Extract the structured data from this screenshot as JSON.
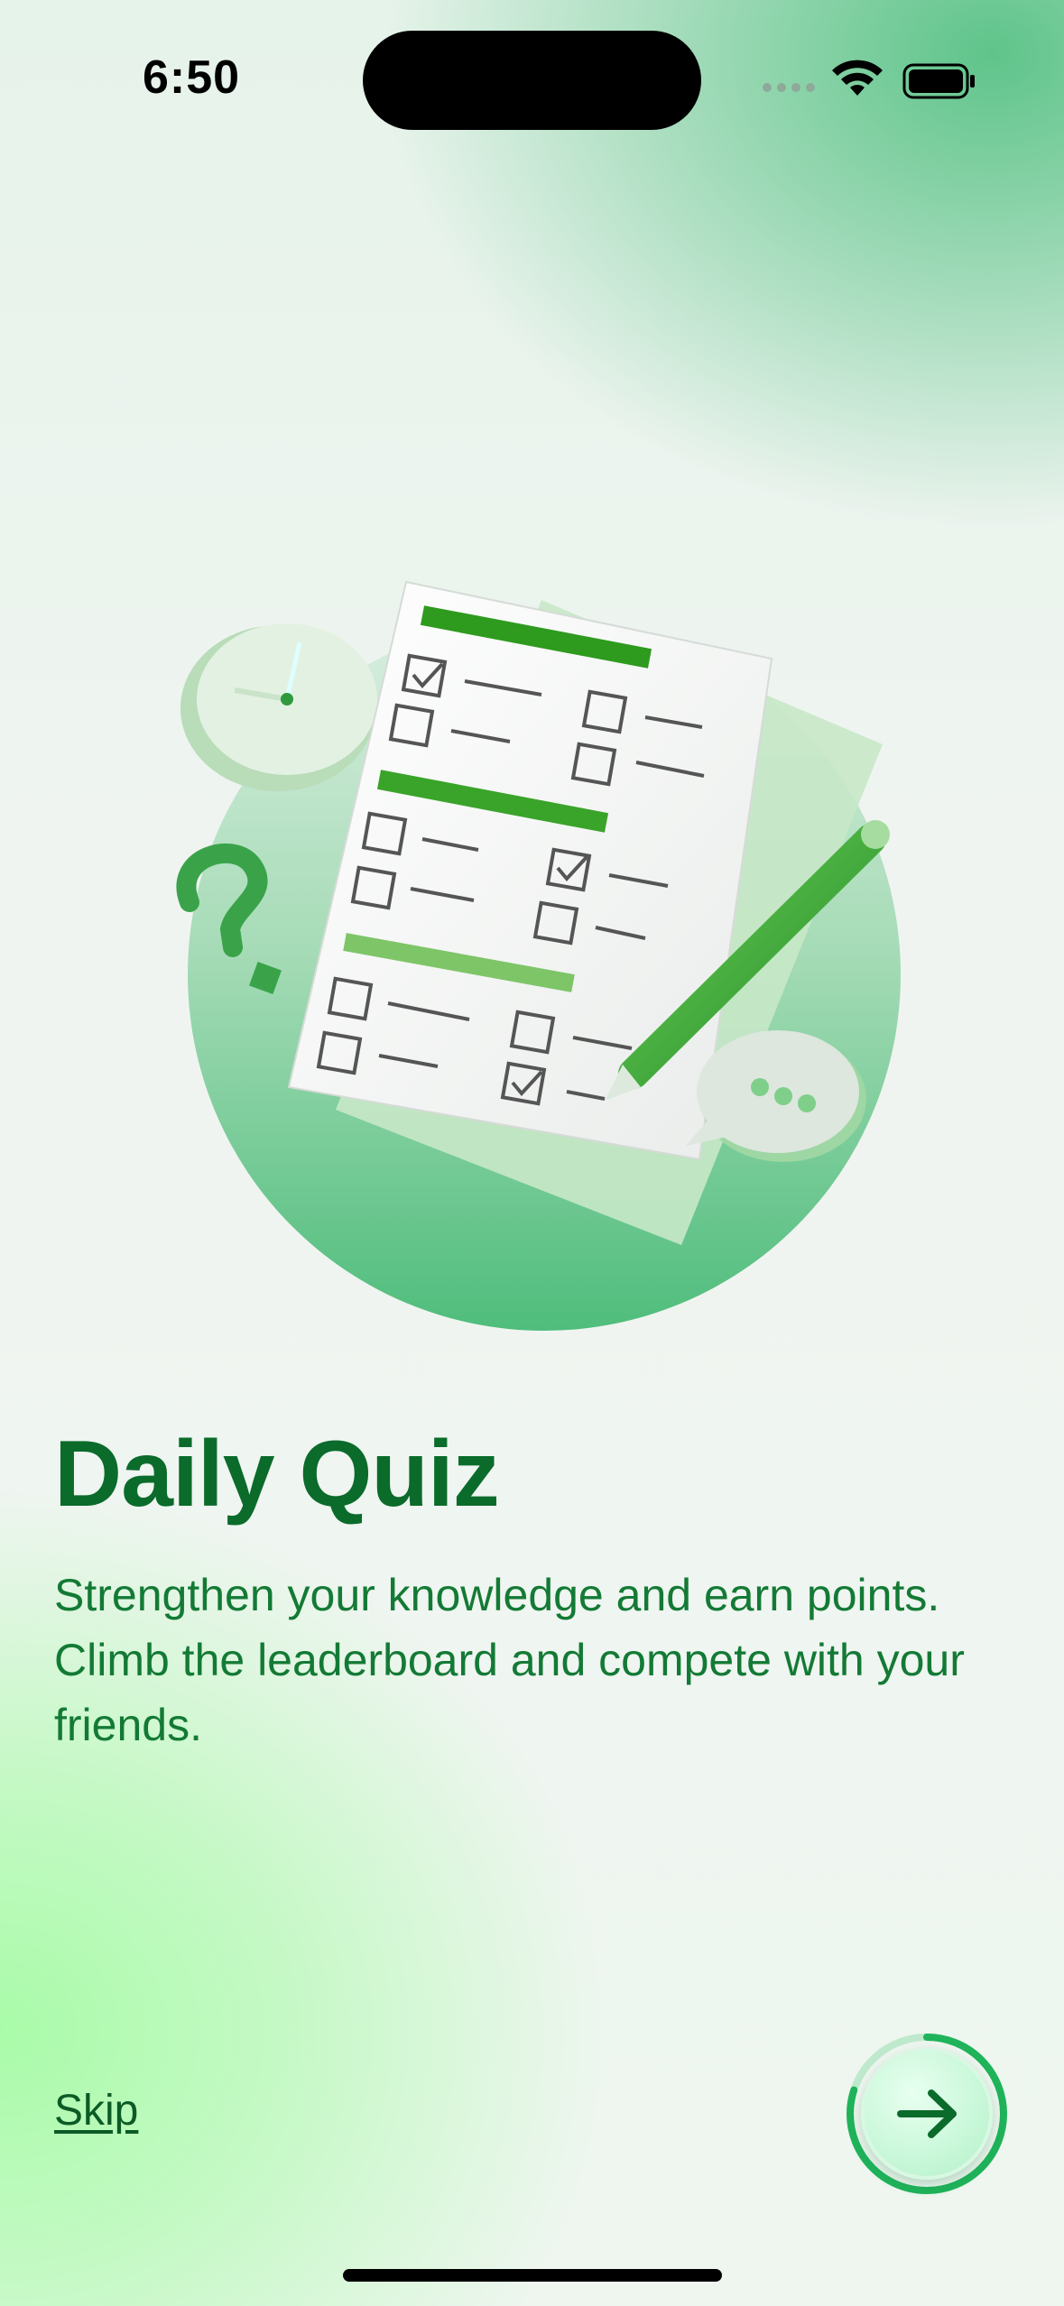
{
  "status_bar": {
    "time": "6:50"
  },
  "onboarding": {
    "title": "Daily Quiz",
    "description": "Strengthen your knowledge and earn points. Climb the leaderboard and compete with your friends.",
    "skip_label": "Skip",
    "next_icon": "arrow-right-icon",
    "progress": 0.8
  },
  "colors": {
    "accent": "#0a6b2b",
    "button_fill": "#c6f7d7",
    "ring": "#1fb35a"
  }
}
